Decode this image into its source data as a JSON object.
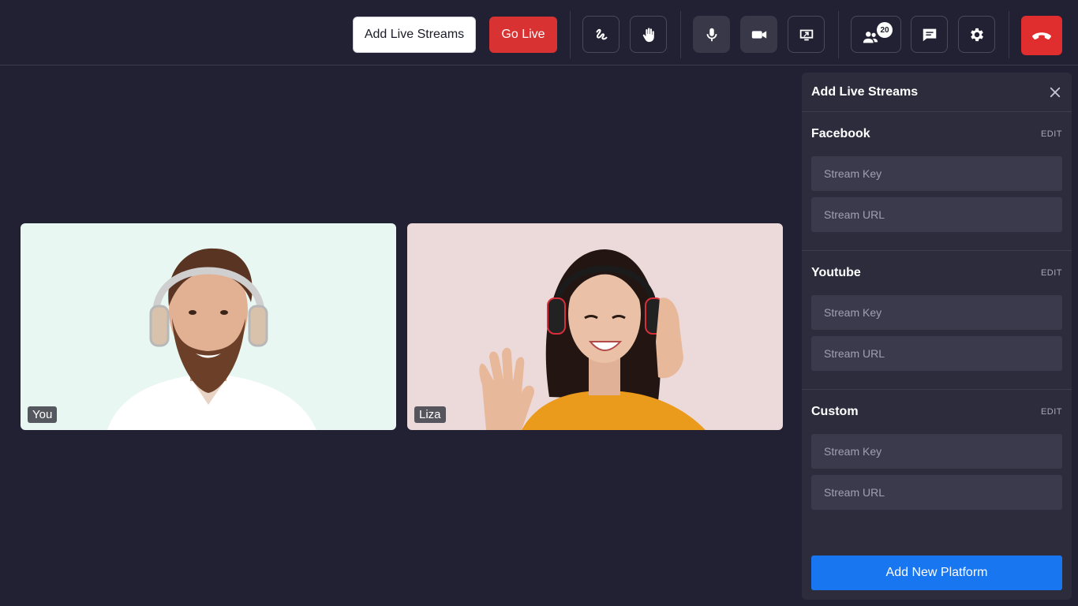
{
  "toolbar": {
    "add_live_streams_label": "Add Live Streams",
    "go_live_label": "Go Live",
    "participants_count": "20"
  },
  "tiles": [
    {
      "name": "You"
    },
    {
      "name": "Liza"
    }
  ],
  "panel": {
    "title": "Add Live Streams",
    "sections": [
      {
        "title": "Facebook",
        "edit": "EDIT",
        "key_placeholder": "Stream Key",
        "url_placeholder": "Stream URL"
      },
      {
        "title": "Youtube",
        "edit": "EDIT",
        "key_placeholder": "Stream Key",
        "url_placeholder": "Stream URL"
      },
      {
        "title": "Custom",
        "edit": "EDIT",
        "key_placeholder": "Stream Key",
        "url_placeholder": "Stream URL"
      }
    ],
    "add_button": "Add New Platform"
  },
  "icons": [
    "squiggle-draw-icon",
    "raise-hand-icon",
    "microphone-icon",
    "video-camera-icon",
    "screen-share-icon",
    "participants-icon",
    "chat-icon",
    "settings-gear-icon",
    "end-call-icon",
    "close-icon"
  ],
  "colors": {
    "background": "#212133",
    "go_live": "#d93232",
    "end_call": "#e02d2d",
    "primary_button": "#1776f0",
    "panel": "#2c2c3d"
  }
}
